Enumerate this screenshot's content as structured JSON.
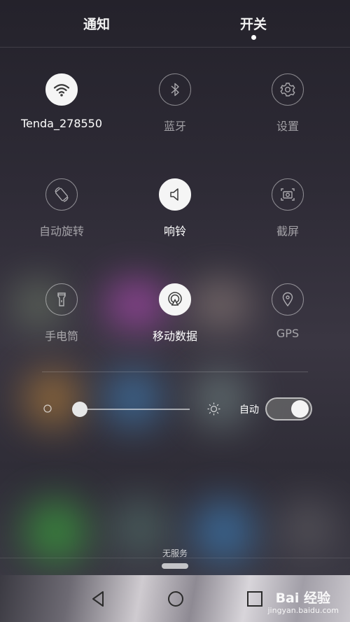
{
  "tabs": [
    {
      "label": "通知",
      "active": false
    },
    {
      "label": "开关",
      "active": true
    }
  ],
  "toggles": [
    {
      "label": "Tenda_278550",
      "icon": "wifi-icon",
      "on": true
    },
    {
      "label": "蓝牙",
      "icon": "bluetooth-icon",
      "on": false
    },
    {
      "label": "设置",
      "icon": "gear-icon",
      "on": false
    },
    {
      "label": "自动旋转",
      "icon": "rotate-icon",
      "on": false
    },
    {
      "label": "响铃",
      "icon": "speaker-icon",
      "on": true
    },
    {
      "label": "截屏",
      "icon": "screenshot-icon",
      "on": false
    },
    {
      "label": "手电筒",
      "icon": "flashlight-icon",
      "on": false
    },
    {
      "label": "移动数据",
      "icon": "mobile-data-icon",
      "on": true
    },
    {
      "label": "GPS",
      "icon": "location-pin-icon",
      "on": false
    }
  ],
  "brightness": {
    "level_percent": 5,
    "auto_label": "自动",
    "auto_on": true
  },
  "status": {
    "no_service": "无服务"
  },
  "watermark": {
    "brand": "Bai 经验",
    "url": "jingyan.baidu.com"
  }
}
